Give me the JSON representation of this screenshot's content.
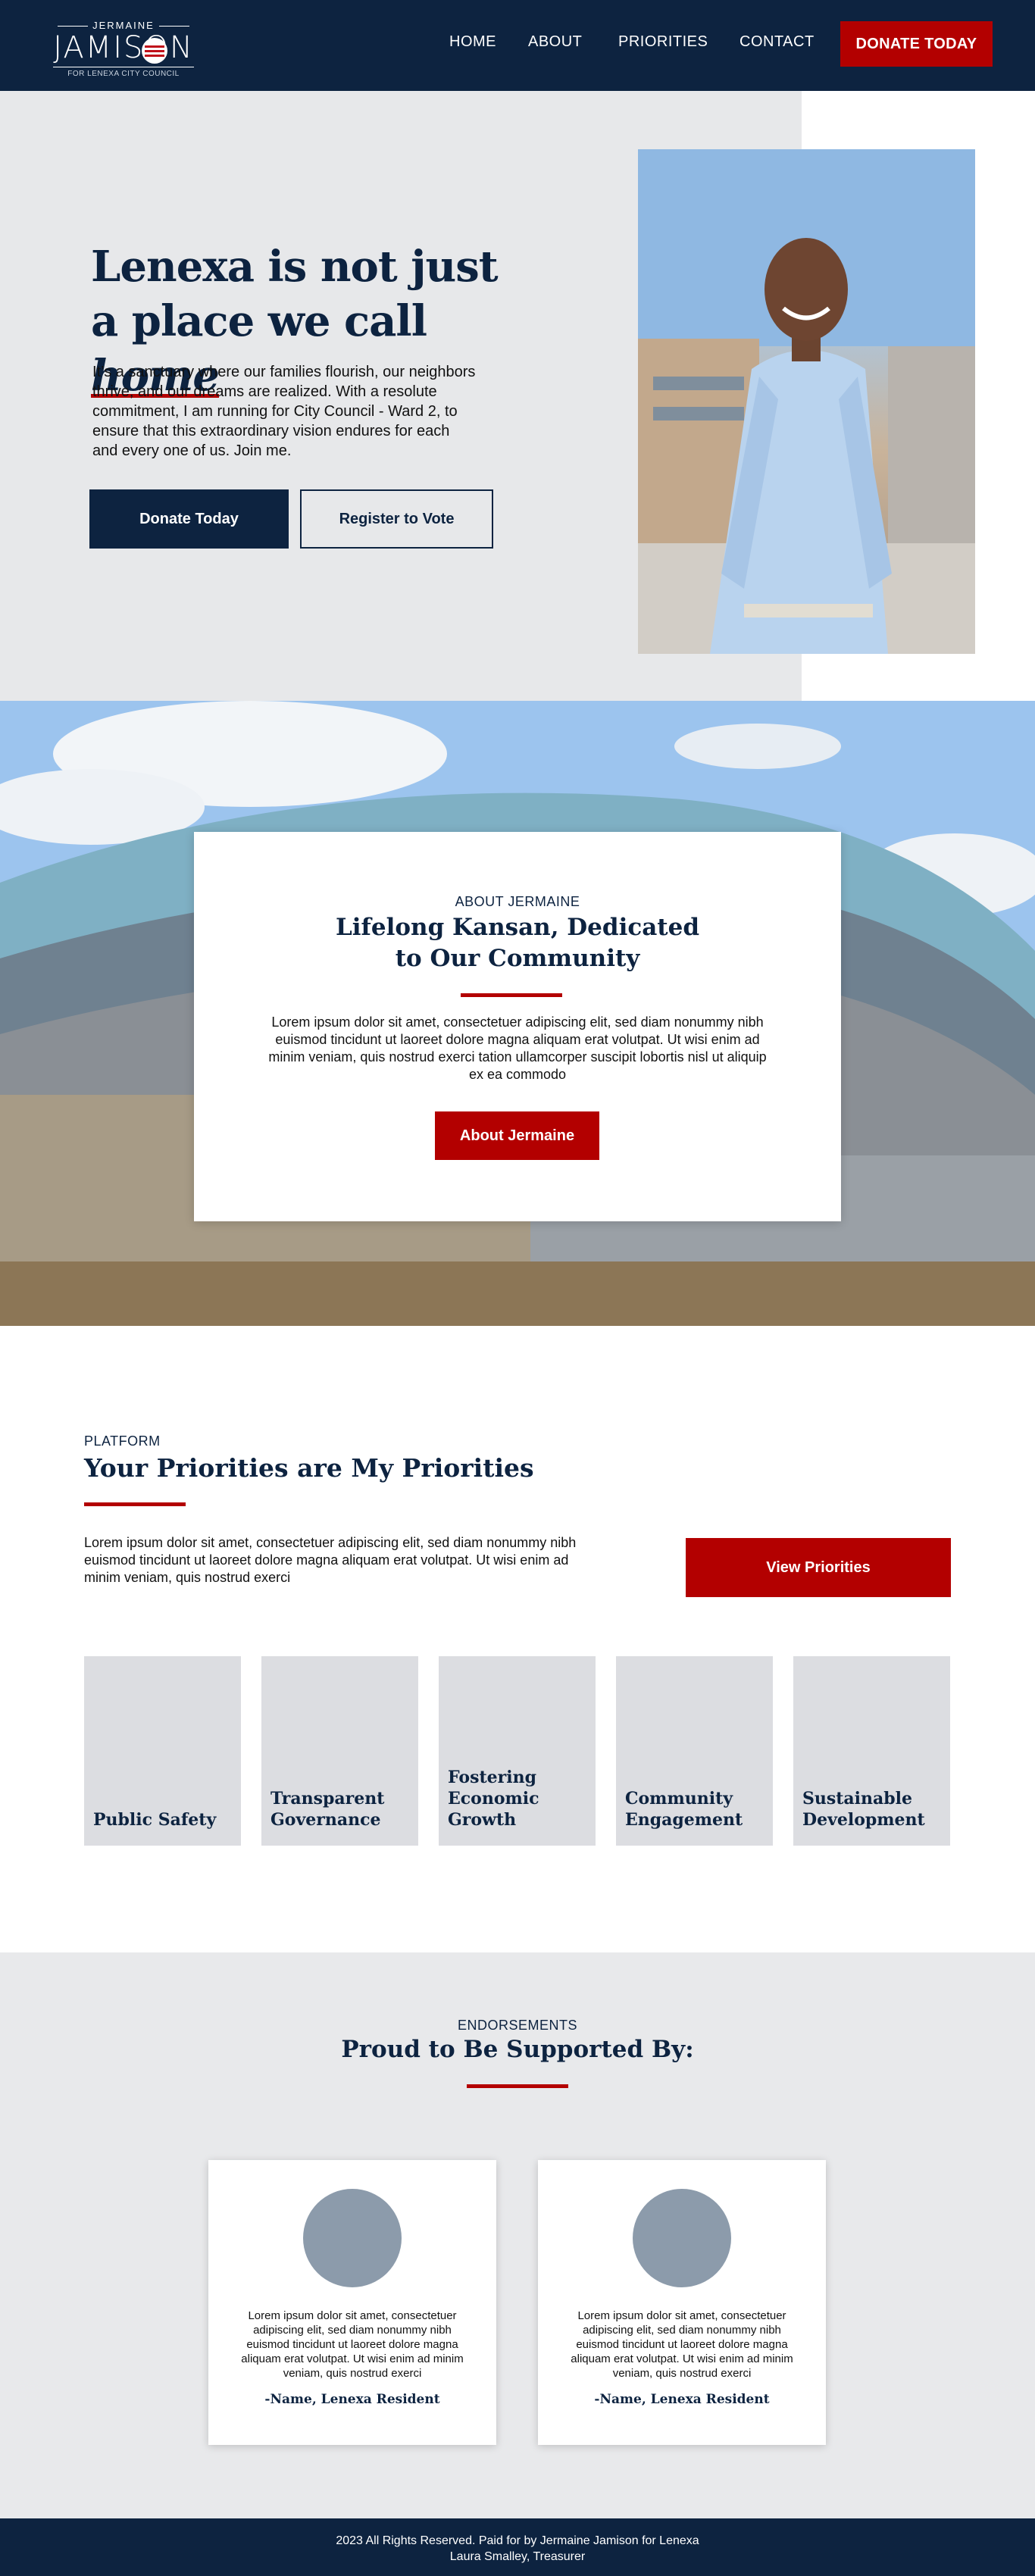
{
  "header": {
    "logo": {
      "top": "JERMAINE",
      "name": "JAMISON",
      "sub": "FOR LENEXA CITY COUNCIL"
    },
    "nav": [
      "HOME",
      "ABOUT",
      "PRIORITIES",
      "CONTACT"
    ],
    "donate_label": "DONATE TODAY"
  },
  "hero": {
    "title_line1": "Lenexa is not just",
    "title_line2_prefix": "a place we call ",
    "title_line2_emphasis": "home",
    "body": "It’s a sanctuary where our families flourish, our neighbors thrive, and our dreams are realized. With a resolute commitment, I am running for City Council - Ward 2, to ensure that this extraordinary vision endures for each and every one of us. Join me.",
    "donate_label": "Donate Today",
    "register_label": "Register to Vote"
  },
  "about": {
    "eyebrow": "ABOUT JERMAINE",
    "title_line1": "Lifelong Kansan, Dedicated",
    "title_line2": "to Our Community",
    "body": "Lorem ipsum dolor sit amet, consectetuer adipiscing elit, sed diam nonummy nibh euismod tincidunt ut laoreet dolore magna aliquam erat volutpat. Ut wisi enim ad minim veniam, quis nostrud exerci tation ullamcorper suscipit lobortis nisl ut aliquip ex ea commodo",
    "button_label": "About Jermaine"
  },
  "platform": {
    "eyebrow": "PLATFORM",
    "title": "Your Priorities are My Priorities",
    "body": "Lorem ipsum dolor sit amet, consectetuer adipiscing elit, sed diam nonummy nibh euismod tincidunt ut laoreet dolore magna aliquam erat volutpat. Ut wisi enim ad minim veniam, quis nostrud exerci",
    "button_label": "View Priorities",
    "tiles": [
      "Public Safety",
      "Transparent Governance",
      "Fostering Economic Growth",
      "Community Engagement",
      "Sustainable Development"
    ]
  },
  "endorsements": {
    "eyebrow": "ENDORSEMENTS",
    "title": "Proud to Be Supported By:",
    "cards": [
      {
        "quote": "Lorem ipsum dolor sit amet, consectetuer adipiscing elit, sed diam nonummy nibh euismod tincidunt ut laoreet dolore magna aliquam erat volutpat. Ut wisi enim ad minim veniam, quis nostrud exerci",
        "name": "-Name, Lenexa Resident"
      },
      {
        "quote": "Lorem ipsum dolor sit amet, consectetuer adipiscing elit, sed diam nonummy nibh euismod tincidunt ut laoreet dolore magna aliquam erat volutpat. Ut wisi enim ad minim veniam, quis nostrud exerci",
        "name": "-Name, Lenexa Resident"
      }
    ]
  },
  "footer": {
    "line1": "2023 All Rights Reserved. Paid for by Jermaine Jamison for Lenexa",
    "line2": "Laura Smalley, Treasurer"
  },
  "colors": {
    "navy": "#0d2340",
    "red": "#b30000",
    "light_gray": "#e7e8ea",
    "tile_gray": "#dcdde1"
  }
}
